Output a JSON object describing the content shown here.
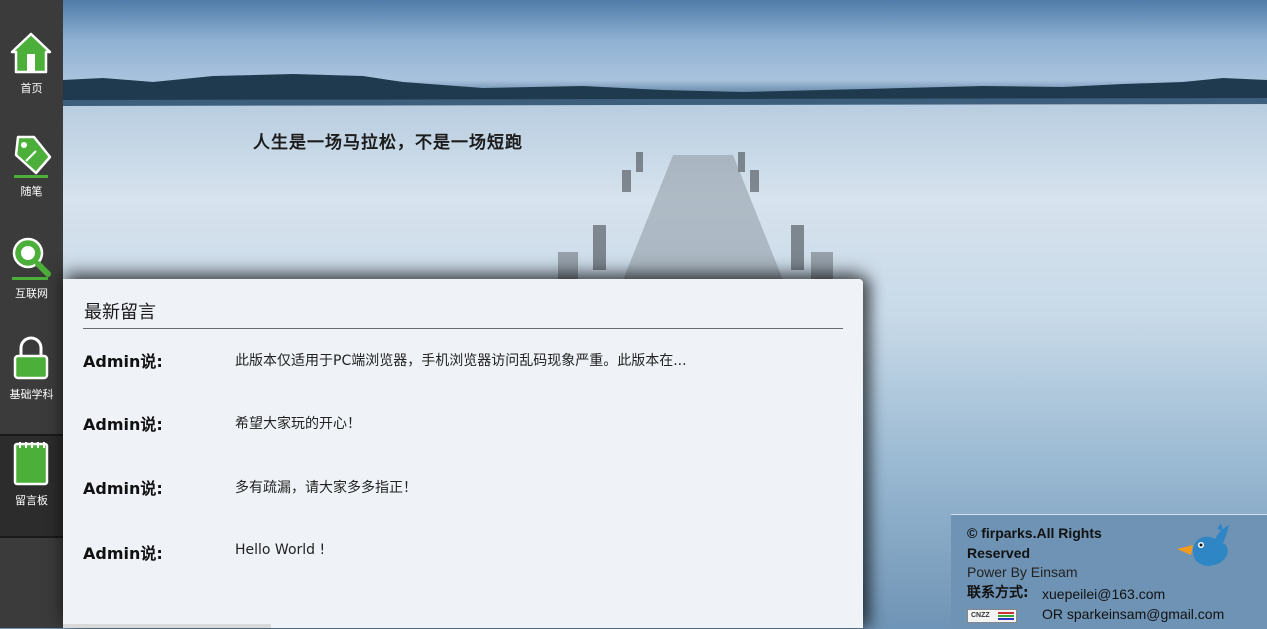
{
  "slogan": "人生是一场马拉松，不是一场短跑",
  "nav": {
    "items": [
      {
        "label": "首页",
        "icon": "home-icon"
      },
      {
        "label": "随笔",
        "icon": "tag-icon"
      },
      {
        "label": "互联网",
        "icon": "magnifier-icon"
      },
      {
        "label": "基础学科",
        "icon": "lock-icon"
      },
      {
        "label": "留言板",
        "icon": "notebook-icon"
      }
    ],
    "active": "留言板"
  },
  "panel": {
    "title": "最新留言",
    "messages": [
      {
        "author": "Admin说:",
        "text": "此版本仅适用于PC端浏览器，手机浏览器访问乱码现象严重。此版本在..."
      },
      {
        "author": "Admin说:",
        "text": "希望大家玩的开心！"
      },
      {
        "author": "Admin说:",
        "text": "多有疏漏，请大家多多指正！"
      },
      {
        "author": "Admin说:",
        "text": "Hello World !"
      }
    ]
  },
  "footer": {
    "copyright": "© firparks.All Rights Reserved",
    "power": "Power By Einsam",
    "contact_label": "联系方式:",
    "email1": "xuepeilei@163.com",
    "email2": "OR sparkeinsam@gmail.com",
    "badge_text": "CNZZ",
    "logo_icon": "bird-icon"
  },
  "colors": {
    "nav_bg": "#3b3b3b",
    "icon_green": "#4caf3a",
    "panel_bg": "#eff3f7",
    "footer_bg": "#6f93b4"
  }
}
